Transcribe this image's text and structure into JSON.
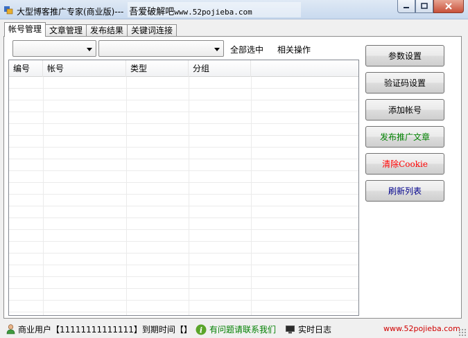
{
  "window": {
    "title": "大型博客推广专家(商业版)---",
    "brand": "吾爱破解吧",
    "url": "www.52pojieba.com"
  },
  "tabs": [
    {
      "label": "帐号管理",
      "active": true
    },
    {
      "label": "文章管理",
      "active": false
    },
    {
      "label": "发布结果",
      "active": false
    },
    {
      "label": "关键词连接",
      "active": false
    }
  ],
  "toolbar": {
    "combo1_value": "",
    "combo2_value": "",
    "select_all": "全部选中",
    "related_ops": "相关操作"
  },
  "list": {
    "columns": [
      "编号",
      "帐号",
      "类型",
      "分组"
    ],
    "rows": []
  },
  "buttons": {
    "params": {
      "label": "参数设置",
      "color": "#000000"
    },
    "captcha": {
      "label": "验证码设置",
      "color": "#000000"
    },
    "add_account": {
      "label": "添加帐号",
      "color": "#000000"
    },
    "publish": {
      "label": "发布推广文章",
      "color": "#008000"
    },
    "clear_cookie": {
      "label": "清除Cookie",
      "color": "#ff0000"
    },
    "refresh": {
      "label": "刷新列表",
      "color": "#00008b"
    }
  },
  "status": {
    "user": "商业用户【11111111111111】到期时间【】",
    "contact": "有问题请联系我们",
    "log": "实时日志",
    "watermark": "www.52pojieba.com"
  },
  "colors": {
    "contact_green": "#008000",
    "watermark_red": "#d00000"
  }
}
